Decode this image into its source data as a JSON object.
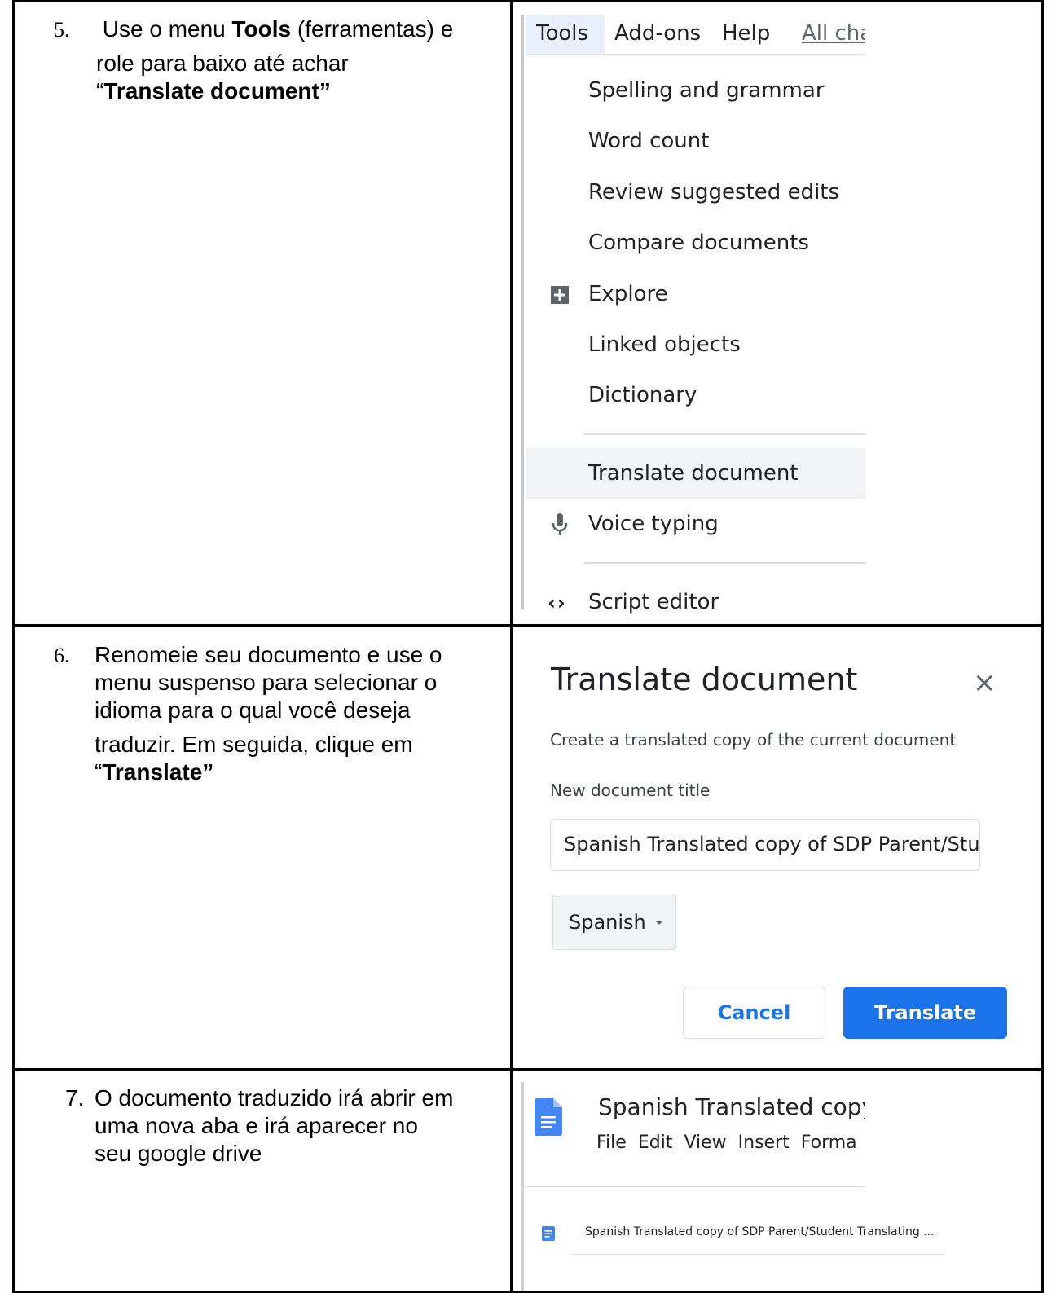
{
  "steps": [
    {
      "number": "5.",
      "text_pre": " Use o menu ",
      "text_bold1": "Tools",
      "text_mid": " (ferramentas) e",
      "text_line2": "role para baixo até achar",
      "text_quote_open": "“",
      "text_bold2": "Translate document”"
    },
    {
      "number": "6.",
      "lines": [
        "Renomeie seu documento e use o",
        "menu suspenso para selecionar o",
        "idioma para o qual você deseja",
        "traduzir. Em seguida, clique em"
      ],
      "text_quote_open": "“",
      "text_bold": "Translate”"
    },
    {
      "number": "7.",
      "lines": [
        "O documento traduzido irá abrir em",
        "uma nova aba e irá aparecer no",
        "seu google drive"
      ]
    }
  ],
  "menu": {
    "menubar": [
      "Tools",
      "Add-ons",
      "Help",
      "All cha"
    ],
    "items": [
      "Spelling and grammar",
      "Word count",
      "Review suggested edits",
      "Compare documents",
      "Explore",
      "Linked objects",
      "Dictionary",
      "Translate document",
      "Voice typing",
      "Script editor"
    ]
  },
  "dialog": {
    "title": "Translate document",
    "subtitle": "Create a translated copy of the current document",
    "field_label": "New document title",
    "field_value": "Spanish Translated copy of SDP Parent/Stuc",
    "language": "Spanish",
    "cancel_label": "Cancel",
    "translate_label": "Translate",
    "close_glyph": "×"
  },
  "docs_header": {
    "title": "Spanish Translated copy c",
    "menu": [
      "File",
      "Edit",
      "View",
      "Insert",
      "Forma"
    ]
  },
  "drive_item": {
    "name": "Spanish Translated copy of SDP Parent/Student Translating ..."
  },
  "colors": {
    "accent": "#1a73e8",
    "docs_icon": "#4285f4",
    "highlight": "#f1f3f4"
  }
}
